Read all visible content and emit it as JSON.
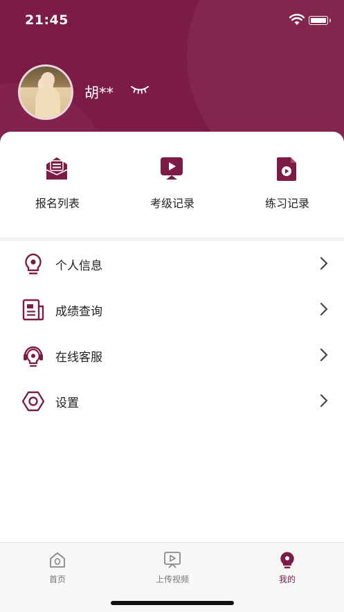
{
  "status_bar": {
    "time": "21:45"
  },
  "profile": {
    "name": "胡**"
  },
  "quick_actions": [
    {
      "label": "报名列表",
      "icon": "envelope-list-icon"
    },
    {
      "label": "考级记录",
      "icon": "play-board-icon"
    },
    {
      "label": "练习记录",
      "icon": "play-file-icon"
    }
  ],
  "menu": [
    {
      "label": "个人信息",
      "icon": "bulb-info-icon"
    },
    {
      "label": "成绩查询",
      "icon": "document-icon"
    },
    {
      "label": "在线客服",
      "icon": "headset-icon"
    },
    {
      "label": "设置",
      "icon": "hex-nut-icon"
    }
  ],
  "tabbar": [
    {
      "label": "首页",
      "icon": "home-icon",
      "active": false
    },
    {
      "label": "上传视频",
      "icon": "upload-video-icon",
      "active": false
    },
    {
      "label": "我的",
      "icon": "profile-bulb-icon",
      "active": true
    }
  ],
  "colors": {
    "brand": "#7c1b45",
    "inactive_tab": "#777777"
  }
}
